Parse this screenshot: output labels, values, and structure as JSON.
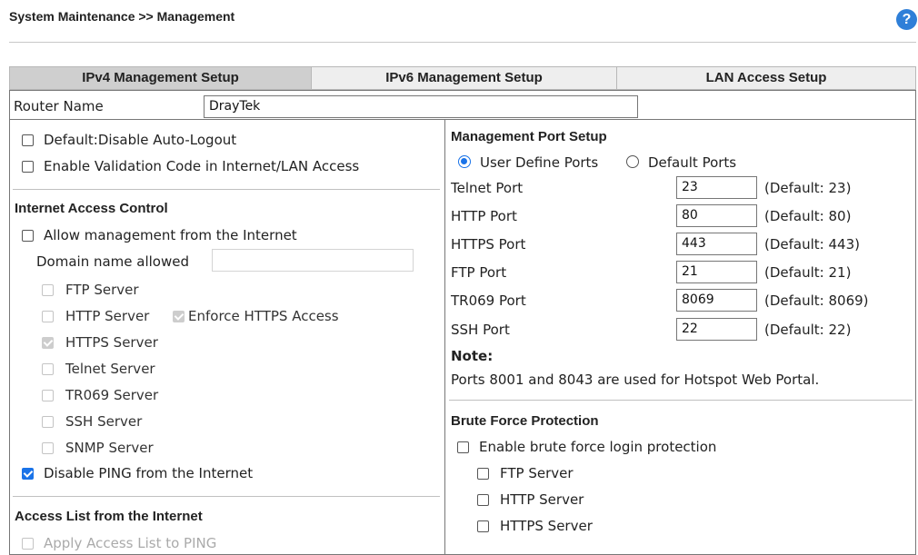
{
  "header": {
    "title": "System Maintenance >> Management",
    "help_icon": "?"
  },
  "tabs": [
    "IPv4 Management Setup",
    "IPv6 Management Setup",
    "LAN Access Setup"
  ],
  "router_name": {
    "label": "Router Name",
    "value": "DrayTek"
  },
  "left": {
    "auto_logout": "Default:Disable Auto-Logout",
    "validation_code": "Enable Validation Code in Internet/LAN Access",
    "internet_access_control": {
      "heading": "Internet Access Control",
      "allow_mgmt": "Allow management from the Internet",
      "domain_label": "Domain name allowed",
      "domain_value": "",
      "servers": [
        "FTP Server",
        "HTTP Server",
        "HTTPS Server",
        "Telnet Server",
        "TR069 Server",
        "SSH Server",
        "SNMP Server"
      ],
      "enforce_https": "Enforce HTTPS Access",
      "disable_ping": "Disable PING from the Internet"
    },
    "access_list": {
      "heading": "Access List from the Internet",
      "apply_ping": "Apply Access List to PING"
    }
  },
  "right": {
    "port_setup": {
      "heading": "Management Port Setup",
      "user_define": "User Define Ports",
      "default_ports": "Default Ports",
      "ports": [
        {
          "label": "Telnet Port",
          "value": "23",
          "default": "(Default: 23)"
        },
        {
          "label": "HTTP Port",
          "value": "80",
          "default": "(Default: 80)"
        },
        {
          "label": "HTTPS Port",
          "value": "443",
          "default": "(Default: 443)"
        },
        {
          "label": "FTP Port",
          "value": "21",
          "default": "(Default: 21)"
        },
        {
          "label": "TR069 Port",
          "value": "8069",
          "default": "(Default: 8069)"
        },
        {
          "label": "SSH Port",
          "value": "22",
          "default": "(Default: 22)"
        }
      ],
      "note_label": "Note:",
      "note_text": "Ports 8001 and 8043 are used for Hotspot Web Portal."
    },
    "brute_force": {
      "heading": "Brute Force Protection",
      "enable": "Enable brute force login protection",
      "servers": [
        "FTP Server",
        "HTTP Server",
        "HTTPS Server"
      ]
    }
  },
  "colors": {
    "accent": "#1a73e8",
    "help": "#2f7fd8",
    "active_tab": "#cfcfcf",
    "tab": "#eeeeee"
  }
}
